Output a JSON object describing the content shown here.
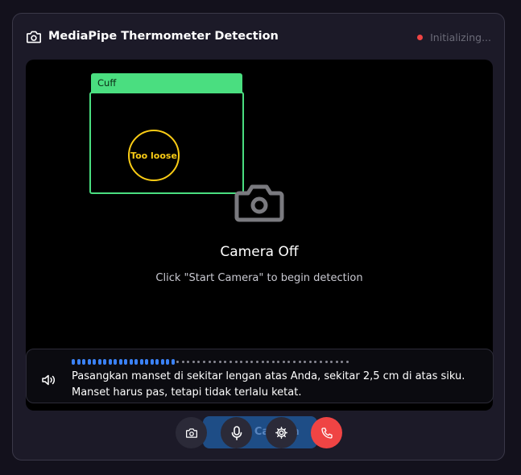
{
  "header": {
    "title": "MediaPipe Thermometer Detection",
    "icon": "camera-icon",
    "status_text": "Initializing...",
    "status_color": "#ef4444"
  },
  "video": {
    "cuff_label": "Cuff",
    "cuff_color": "#4ade80",
    "fit_status": "Too loose",
    "fit_color": "#facc15",
    "camera_off_title": "Camera Off",
    "camera_off_hint": "Click \"Start Camera\" to begin detection"
  },
  "caption": {
    "icon": "speaker-icon",
    "text": "Pasangkan manset di sekitar lengan atas Anda, sekitar 2,5 cm di atas siku. Manset harus pas, tetapi tidak terlalu ketat.",
    "progress_filled": 0.38
  },
  "controls": {
    "start_camera_label": "Start Camera",
    "camera_icon": "camera-icon",
    "mic_icon": "microphone-icon",
    "settings_icon": "gear-icon",
    "end_call_icon": "phone-icon",
    "end_call_color": "#ef4444"
  }
}
